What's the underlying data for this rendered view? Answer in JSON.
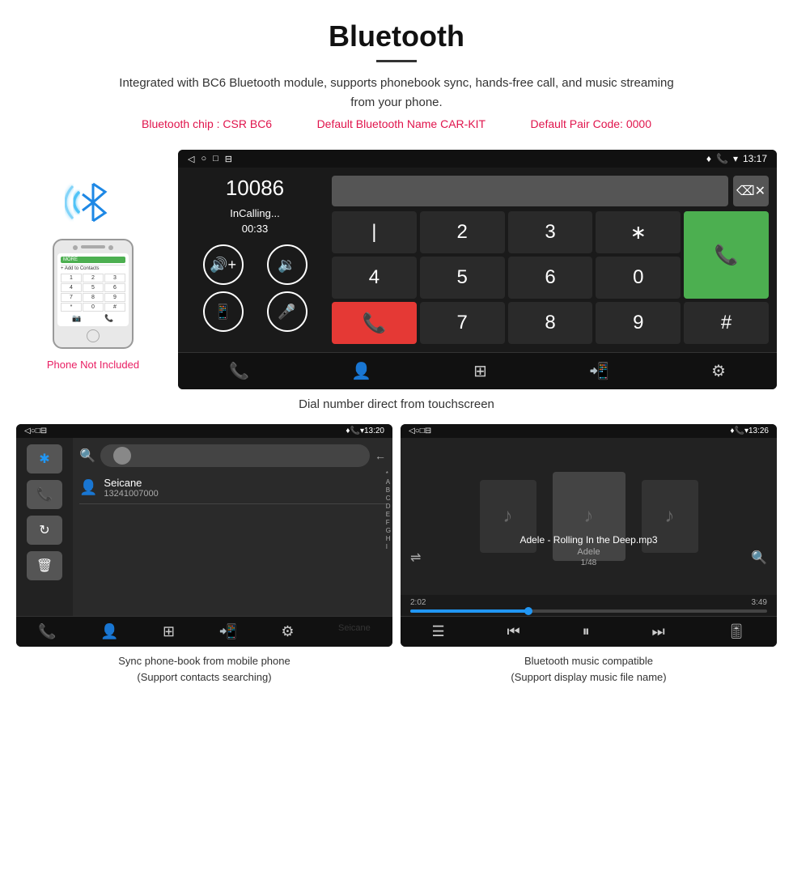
{
  "header": {
    "title": "Bluetooth",
    "description": "Integrated with BC6 Bluetooth module, supports phonebook sync, hands-free call, and music streaming from your phone.",
    "spec_chip": "Bluetooth chip : CSR BC6",
    "spec_name": "Default Bluetooth Name CAR-KIT",
    "spec_code": "Default Pair Code: 0000"
  },
  "car_screen": {
    "status_bar": {
      "nav_back": "◁",
      "nav_home": "○",
      "nav_recent": "□",
      "nav_extra": "⊟",
      "icons_right": "♦ 📞 ▾ 13:17"
    },
    "dial": {
      "number": "10086",
      "status": "InCalling...",
      "timer": "00:33"
    },
    "numpad_keys": [
      "1",
      "2",
      "3",
      "*",
      "4",
      "5",
      "6",
      "0",
      "7",
      "8",
      "9",
      "#"
    ],
    "call_answer_label": "📞",
    "call_end_label": "📞",
    "backspace": "⌫",
    "bottom_icons": [
      "📞",
      "👤",
      "⊞",
      "📲",
      "⚙"
    ]
  },
  "caption_main": "Dial number direct from touchscreen",
  "phone_mockup": {
    "contact_line": "Add to Contacts",
    "numpad_keys": [
      "1",
      "2",
      "3",
      "4",
      "5",
      "6",
      "*",
      "0",
      "#"
    ],
    "bottom_icons": [
      "📷",
      "📞"
    ]
  },
  "phone_not_included": "Phone Not Included",
  "bottom_left": {
    "status_bar": "◁  ○  □  ⊟         ♦ 📞 ▾ 13:20",
    "contact_name": "Seicane",
    "contact_phone": "13241007000",
    "alpha_list": [
      "*",
      "A",
      "B",
      "C",
      "D",
      "E",
      "F",
      "G",
      "H",
      "I"
    ],
    "bottom_icons": [
      "📞",
      "👤",
      "⊞",
      "📲",
      "⚙"
    ],
    "caption_line1": "Sync phone-book from mobile phone",
    "caption_line2": "(Support contacts searching)"
  },
  "bottom_right": {
    "status_bar": "◁  ○  □  ⊟         ♦ 📞 ▾ 13:26",
    "song_title": "Adele - Rolling In the Deep.mp3",
    "artist": "Adele",
    "track_info": "1/48",
    "time_current": "2:02",
    "time_total": "3:49",
    "progress_pct": 33,
    "bottom_icons": [
      "☰",
      "⏮",
      "⏸",
      "⏭",
      "🎚"
    ],
    "caption_line1": "Bluetooth music compatible",
    "caption_line2": "(Support display music file name)"
  }
}
